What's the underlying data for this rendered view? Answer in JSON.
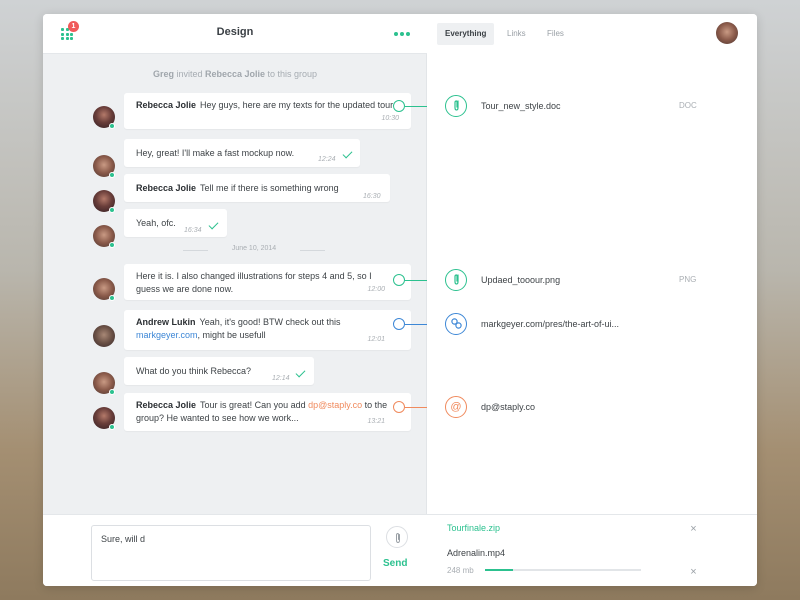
{
  "chat": {
    "title": "Design",
    "notification_count": "1",
    "system_message": {
      "actor": "Greg",
      "text_1": " invited ",
      "target": "Rebecca Jolie",
      "text_2": " to this group"
    },
    "date_separator": "June 10, 2014",
    "messages": [
      {
        "author": "Rebecca Jolie",
        "text": "Hey guys, here are my texts for the updated tour",
        "time": "10:30"
      },
      {
        "author": "",
        "text": "Hey, great! I'll make a fast mockup now.",
        "time": "12:24"
      },
      {
        "author": "Rebecca Jolie",
        "text": "Tell me if there is something wrong",
        "time": "16:30"
      },
      {
        "author": "",
        "text": "Yeah, ofc.",
        "time": "16:34"
      },
      {
        "author": "",
        "text": "Here it is. I also changed illustrations for steps 4 and 5, so I guess we are done now.",
        "time": "12:00"
      },
      {
        "author": "Andrew Lukin",
        "text_1": "Yeah, it's good! BTW check out this ",
        "link": "markgeyer.com",
        "text_2": ", might be usefull",
        "time": "12:01"
      },
      {
        "author": "",
        "text": "What do you think Rebecca?",
        "time": "12:14"
      },
      {
        "author": "Rebecca Jolie",
        "text_1": "Tour is great! Can you add ",
        "link": "dp@staply.co",
        "text_2": " to the group? He wanted to see how we work...",
        "time": "13:21"
      }
    ]
  },
  "composer": {
    "value": "Sure, will d",
    "send_label": "Send"
  },
  "sidebar": {
    "tabs": [
      {
        "label": "Everything",
        "active": true
      },
      {
        "label": "Links",
        "active": false
      },
      {
        "label": "Files",
        "active": false
      }
    ],
    "items": [
      {
        "name": "Tour_new_style.doc",
        "type": "DOC",
        "icon": "paperclip-icon"
      },
      {
        "name": "Updaed_tooour.png",
        "type": "PNG",
        "icon": "paperclip-icon"
      },
      {
        "name": "markgeyer.com/pres/the-art-of-ui...",
        "type": "",
        "icon": "link-icon"
      },
      {
        "name": "dp@staply.co",
        "type": "",
        "icon": "at-icon"
      }
    ],
    "uploads": [
      {
        "name": "Tourfinale.zip"
      },
      {
        "name": "Adrenalin.mp4",
        "size": "248 mb",
        "progress": 0.18
      }
    ]
  },
  "colors": {
    "accent": "#2cc18f",
    "link": "#3d87d6",
    "mention": "#f08a5d",
    "badge": "#f05a5a"
  }
}
